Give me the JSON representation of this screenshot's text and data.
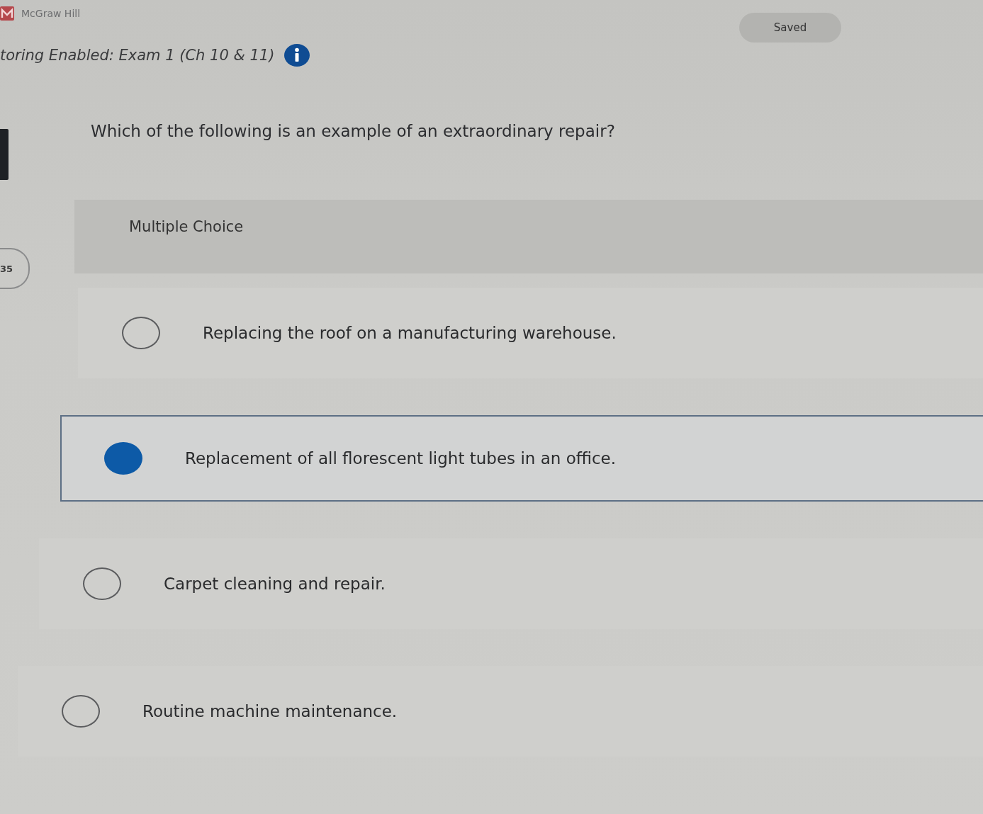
{
  "header": {
    "brand": "McGraw Hill"
  },
  "assignment": {
    "title": "toring Enabled: Exam 1 (Ch 10 & 11)",
    "status": "Saved"
  },
  "question": {
    "number": "35",
    "prompt": "Which of the following is an example of an extraordinary repair?",
    "type_label": "Multiple Choice",
    "options": [
      {
        "text": "Replacing the roof on a manufacturing warehouse.",
        "selected": false
      },
      {
        "text": "Replacement of all florescent light tubes in an office.",
        "selected": true
      },
      {
        "text": "Carpet cleaning and repair.",
        "selected": false
      },
      {
        "text": "Routine machine maintenance.",
        "selected": false
      }
    ]
  }
}
